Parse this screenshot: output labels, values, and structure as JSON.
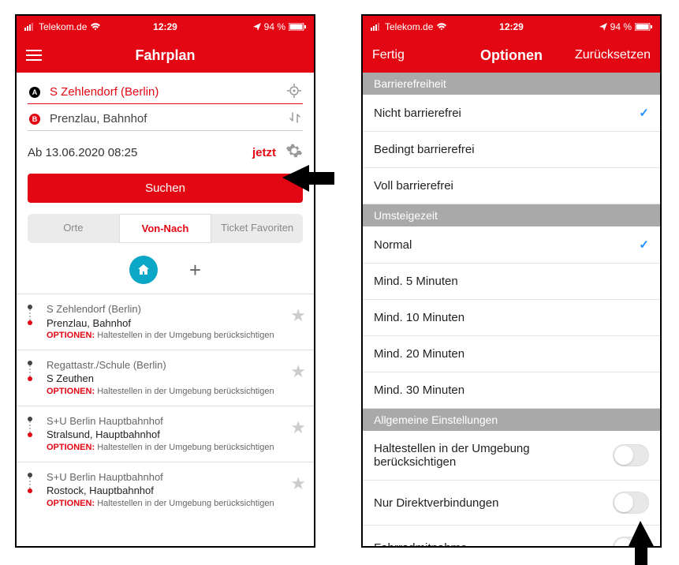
{
  "status": {
    "carrier": "Telekom.de",
    "time": "12:29",
    "battery": "94 %"
  },
  "left": {
    "header": {
      "title": "Fahrplan"
    },
    "stationA": "S Zehlendorf (Berlin)",
    "stationB": "Prenzlau, Bahnhof",
    "datetime": "Ab 13.06.2020 08:25",
    "now_label": "jetzt",
    "search_button": "Suchen",
    "tabs": {
      "orte": "Orte",
      "vonnach": "Von-Nach",
      "tickets": "Ticket Favoriten"
    },
    "opt_label": "OPTIONEN:",
    "opt_text": "Haltestellen in der Umgebung berücksichtigen",
    "history": [
      {
        "from": "S Zehlendorf (Berlin)",
        "to": "Prenzlau, Bahnhof"
      },
      {
        "from": "Regattastr./Schule (Berlin)",
        "to": "S Zeuthen"
      },
      {
        "from": "S+U Berlin Hauptbahnhof",
        "to": "Stralsund, Hauptbahnhof"
      },
      {
        "from": "S+U Berlin Hauptbahnhof",
        "to": "Rostock, Hauptbahnhof"
      }
    ]
  },
  "right": {
    "header": {
      "left": "Fertig",
      "title": "Optionen",
      "right": "Zurücksetzen"
    },
    "sections": {
      "access": {
        "title": "Barrierefreiheit",
        "items": [
          "Nicht barrierefrei",
          "Bedingt barrierefrei",
          "Voll barrierefrei"
        ],
        "selected": 0
      },
      "transfer": {
        "title": "Umsteigezeit",
        "items": [
          "Normal",
          "Mind. 5 Minuten",
          "Mind. 10 Minuten",
          "Mind. 20 Minuten",
          "Mind. 30 Minuten"
        ],
        "selected": 0
      },
      "general": {
        "title": "Allgemeine Einstellungen",
        "items": [
          "Haltestellen in der Umgebung berücksichtigen",
          "Nur Direktverbindungen",
          "Fahrradmitnahme"
        ]
      }
    }
  }
}
